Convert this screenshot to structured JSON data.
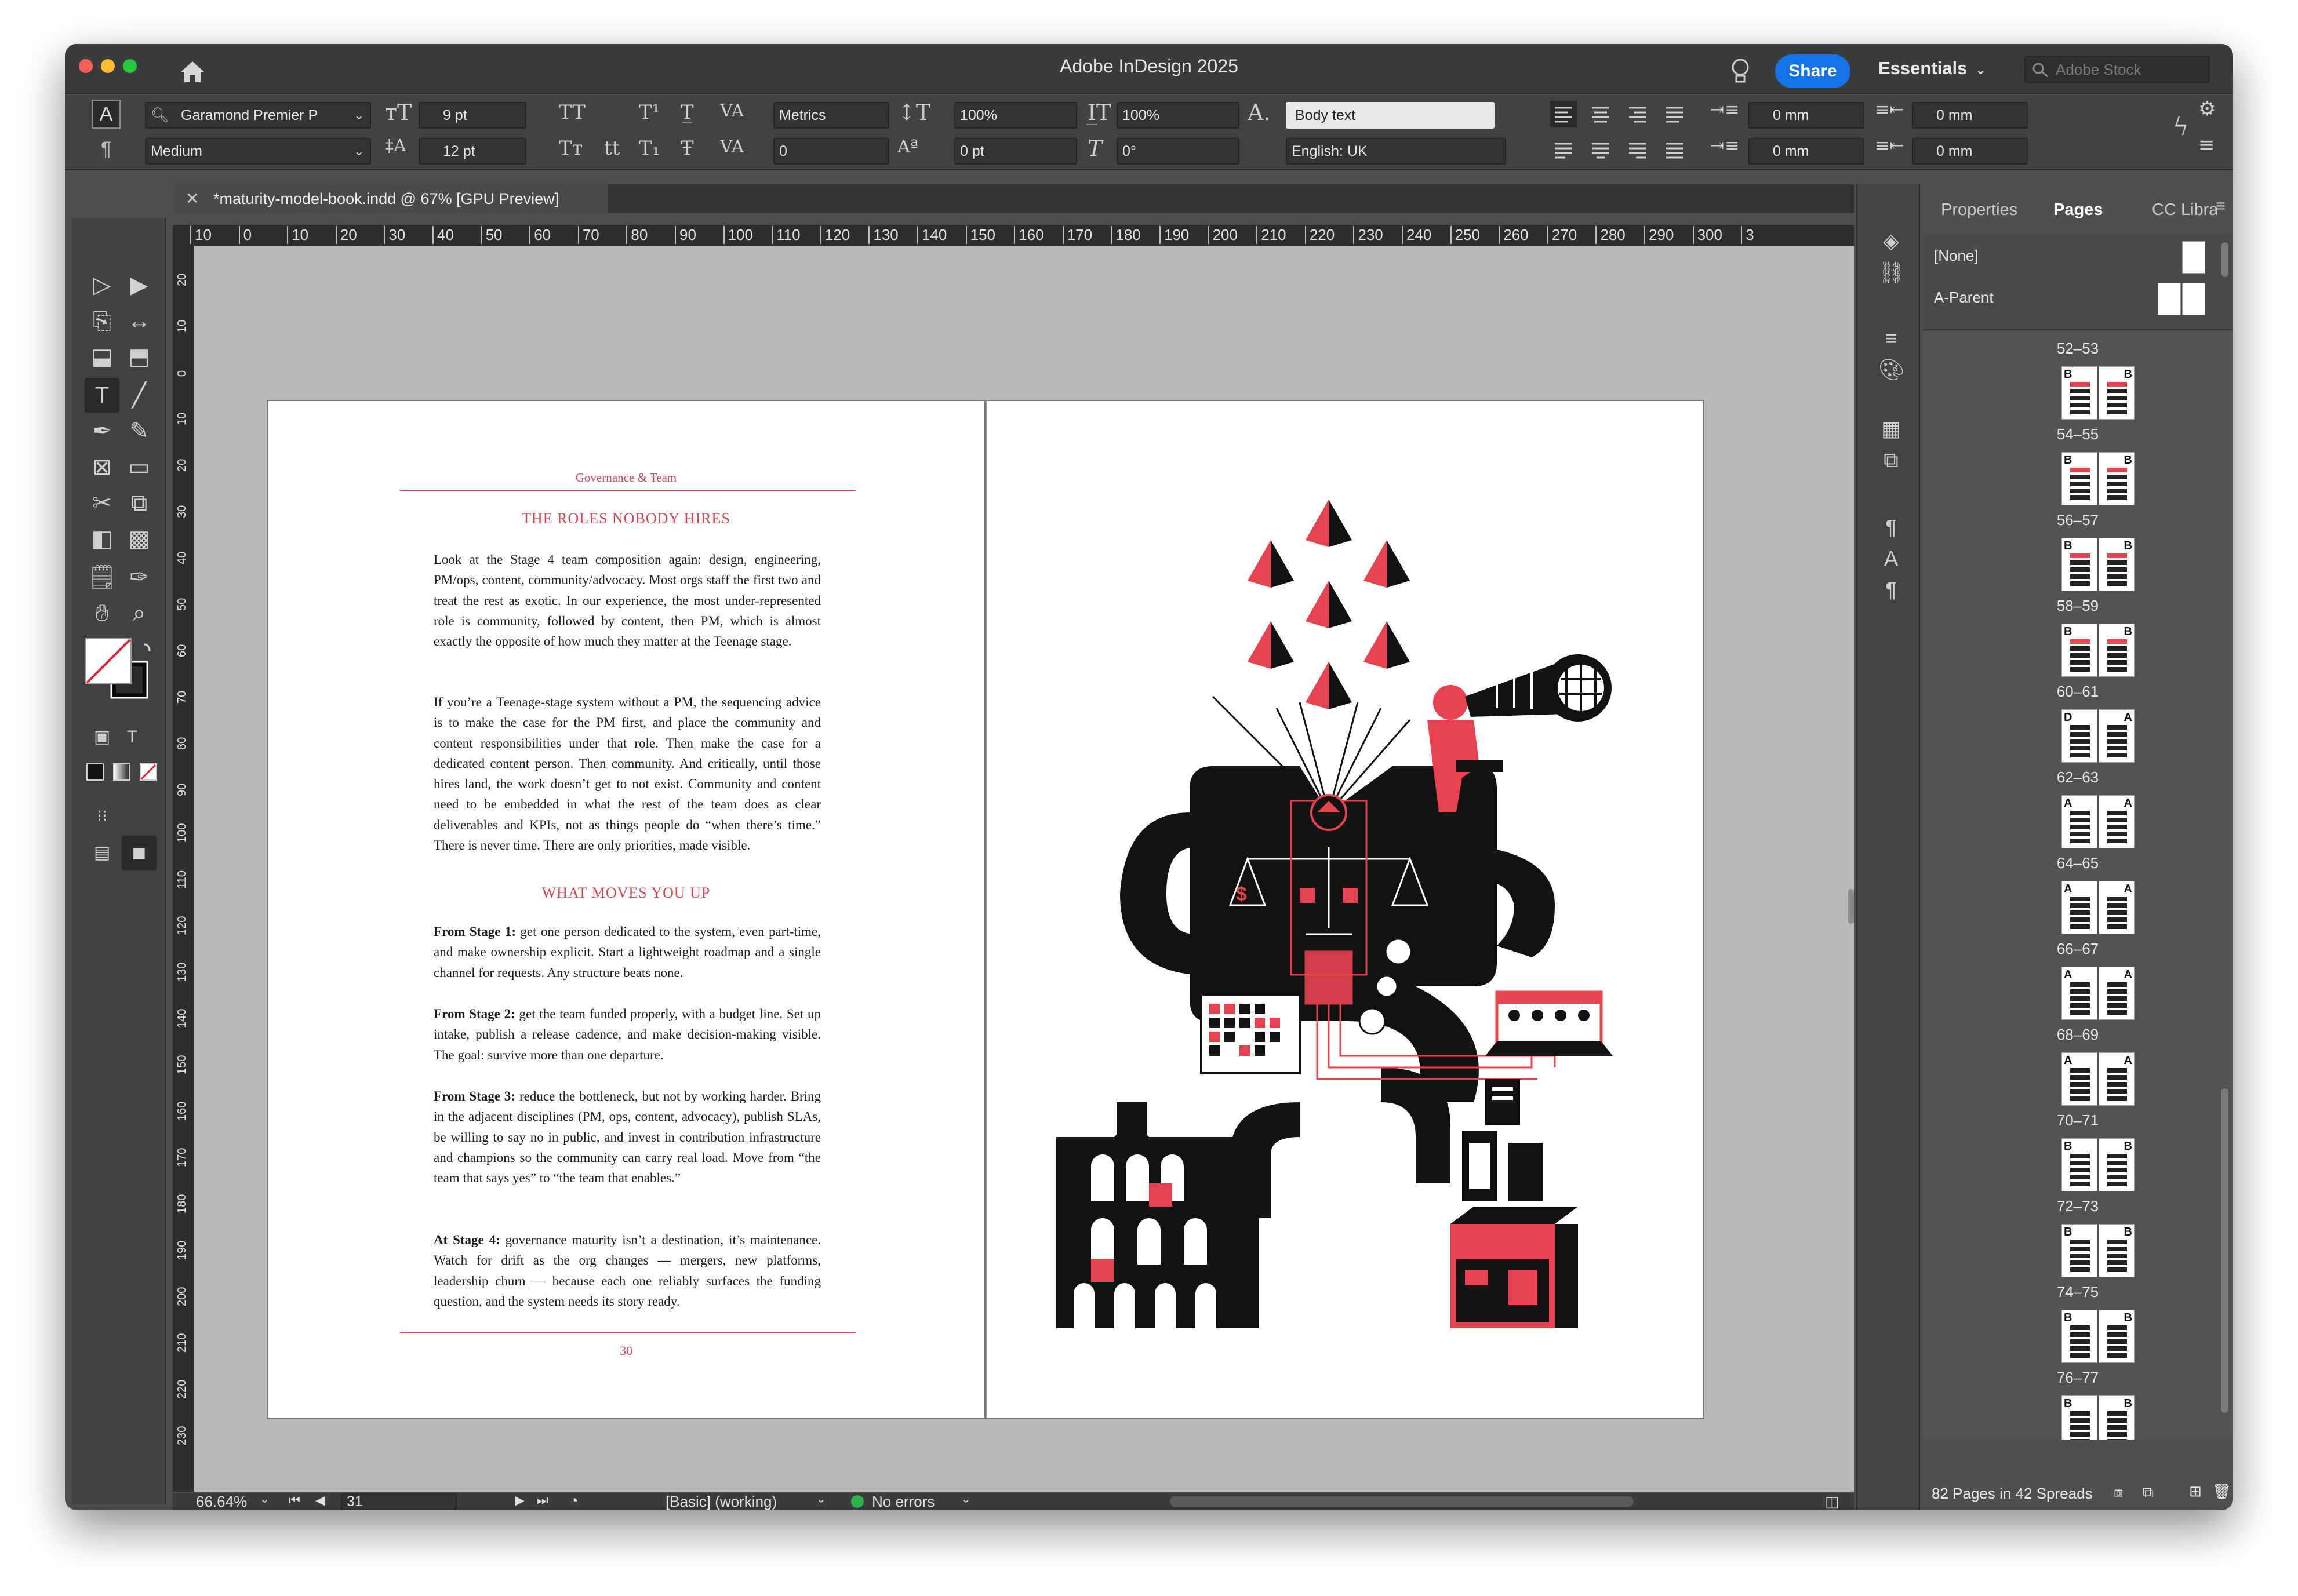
{
  "app": {
    "title": "Adobe InDesign 2025",
    "share_label": "Share",
    "workspace": "Essentials",
    "stock_placeholder": "Adobe Stock"
  },
  "control": {
    "font_family": "Garamond Premier P",
    "font_style": "Medium",
    "font_size": "9 pt",
    "leading": "12 pt",
    "kerning": "Metrics",
    "tracking": "0",
    "v_scale": "100%",
    "h_scale": "100%",
    "baseline_shift": "0 pt",
    "skew": "0°",
    "para_style": "Body text",
    "language": "English: UK",
    "left_indent": "0 mm",
    "right_indent": "0 mm",
    "first_indent": "0 mm",
    "last_indent": "0 mm"
  },
  "document": {
    "tab_label": "*maturity-model-book.indd @ 67% [GPU Preview]"
  },
  "ruler": {
    "h_ticks": [
      "10",
      "0",
      "10",
      "20",
      "30",
      "40",
      "50",
      "60",
      "70",
      "80",
      "90",
      "100",
      "110",
      "120",
      "130",
      "140",
      "150",
      "160",
      "170",
      "180",
      "190",
      "200",
      "210",
      "220",
      "230",
      "240",
      "250",
      "260",
      "270",
      "280",
      "290",
      "300",
      "3"
    ]
  },
  "left_page": {
    "running_head": "Governance & Team",
    "heading1": "THE ROLES NOBODY HIRES",
    "p1": "Look at the Stage 4 team composition again: design, engineering, PM/ops, content, community/advocacy. Most orgs staff the first two and treat the rest as exotic. In our experience, the most under-represented role is community, followed by content, then PM, which is almost exactly the opposite of how much they matter at the Teenage stage.",
    "p2": "If you’re a Teenage-stage system without a PM, the sequencing advice is to make the case for the PM first, and place the community and content responsibilities under that role. Then make the case for a dedicated content person. Then community. And critically, until those hires land, the work doesn’t get to not exist. Community and content need to be embedded in what the rest of the team does as clear deliverables and KPIs, not as things people do “when there’s time.” There is never time. There are only priorities, made visible.",
    "heading2": "WHAT MOVES YOU UP",
    "s1_lead": "From Stage 1:",
    "s1_text": " get one person dedicated to the system, even part-time, and make ownership explicit. Start a lightweight roadmap and a single channel for requests. Any structure beats none.",
    "s2_lead": "From Stage 2:",
    "s2_text": " get the team funded properly, with a budget line. Set up intake, publish a release cadence, and make decision-making visible. The goal: survive more than one departure.",
    "s3_lead": "From Stage 3:",
    "s3_text": " reduce the bottleneck, but not by working harder. Bring in the adjacent disciplines (PM, ops, content, advocacy), publish SLAs, be willing to say no in public, and invest in contribution infrastructure and champions so the community can carry real load. Move from “the team that says yes” to “the team that enables.”",
    "s4_lead": "At Stage 4:",
    "s4_text": " governance maturity isn’t a destination, it’s maintenance. Watch for drift as the org changes — mergers, new platforms, leadership churn — because each one reliably surfaces the funding question, and the system needs its story ready.",
    "folio": "30"
  },
  "status": {
    "zoom": "66.64%",
    "page": "31",
    "preflight_profile": "[Basic] (working)",
    "errors": "No errors"
  },
  "pages_panel": {
    "tabs": [
      "Properties",
      "Pages",
      "CC Libraries"
    ],
    "parents": [
      {
        "name": "[None]"
      },
      {
        "name": "A-Parent"
      }
    ],
    "spreads": [
      {
        "label": "52–53",
        "l": "B",
        "r": "B"
      },
      {
        "label": "54–55",
        "l": "B",
        "r": "B"
      },
      {
        "label": "56–57",
        "l": "B",
        "r": "B"
      },
      {
        "label": "58–59",
        "l": "B",
        "r": "B"
      },
      {
        "label": "60–61",
        "l": "D",
        "r": "A"
      },
      {
        "label": "62–63",
        "l": "A",
        "r": "A"
      },
      {
        "label": "64–65",
        "l": "A",
        "r": "A"
      },
      {
        "label": "66–67",
        "l": "A",
        "r": "A"
      },
      {
        "label": "68–69",
        "l": "A",
        "r": "A"
      },
      {
        "label": "70–71",
        "l": "B",
        "r": "B"
      },
      {
        "label": "72–73",
        "l": "B",
        "r": "B"
      },
      {
        "label": "74–75",
        "l": "B",
        "r": "B"
      },
      {
        "label": "76–77",
        "l": "B",
        "r": "B"
      }
    ],
    "footer": "82 Pages in 42 Spreads"
  },
  "colors": {
    "accent": "#d74550",
    "share_blue": "#1473e6",
    "illustration_red": "#e8424f",
    "illustration_black": "#121212"
  }
}
